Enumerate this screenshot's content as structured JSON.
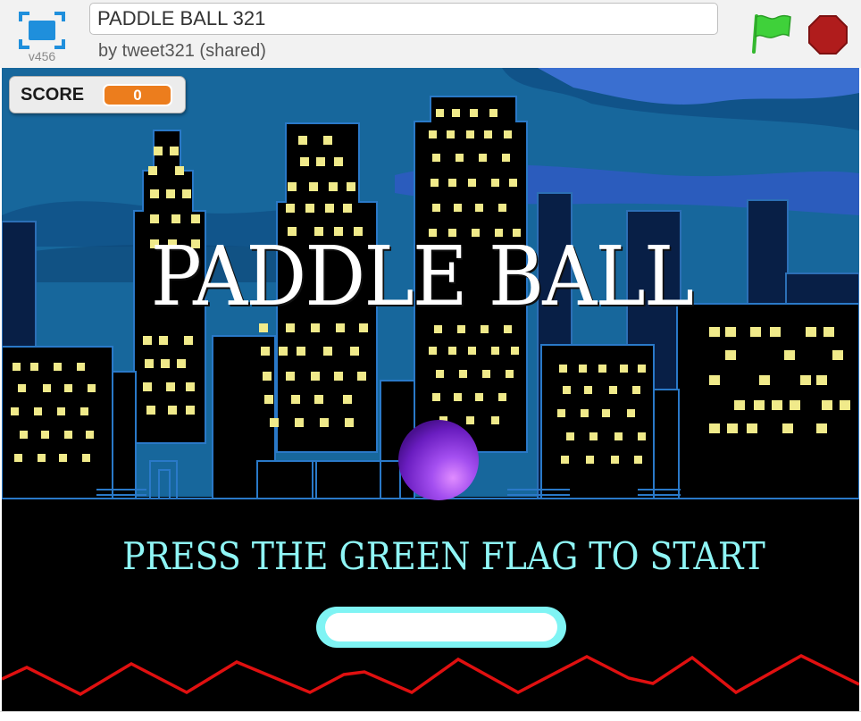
{
  "player": {
    "project_title": "PADDLE BALL 321",
    "byline": "by tweet321 (shared)",
    "version": "v456",
    "fullscreen_icon": "fullscreen-icon",
    "green_flag_icon": "green-flag-icon",
    "stop_icon": "stop-sign-icon"
  },
  "stage": {
    "score_monitor": {
      "label": "SCORE",
      "value": "0"
    },
    "title_text": "PADDLE BALL",
    "start_message": "PRESS THE GREEN FLAG TO START"
  },
  "colors": {
    "flag_green": "#3fd13a",
    "stop_red": "#b01c1c",
    "score_orange": "#ec7d1d",
    "message_cyan": "#8ff6f6",
    "ball_purple": "#9a34e6",
    "paddle_cyan": "#7ff4f4",
    "zigzag_red": "#e01010"
  }
}
